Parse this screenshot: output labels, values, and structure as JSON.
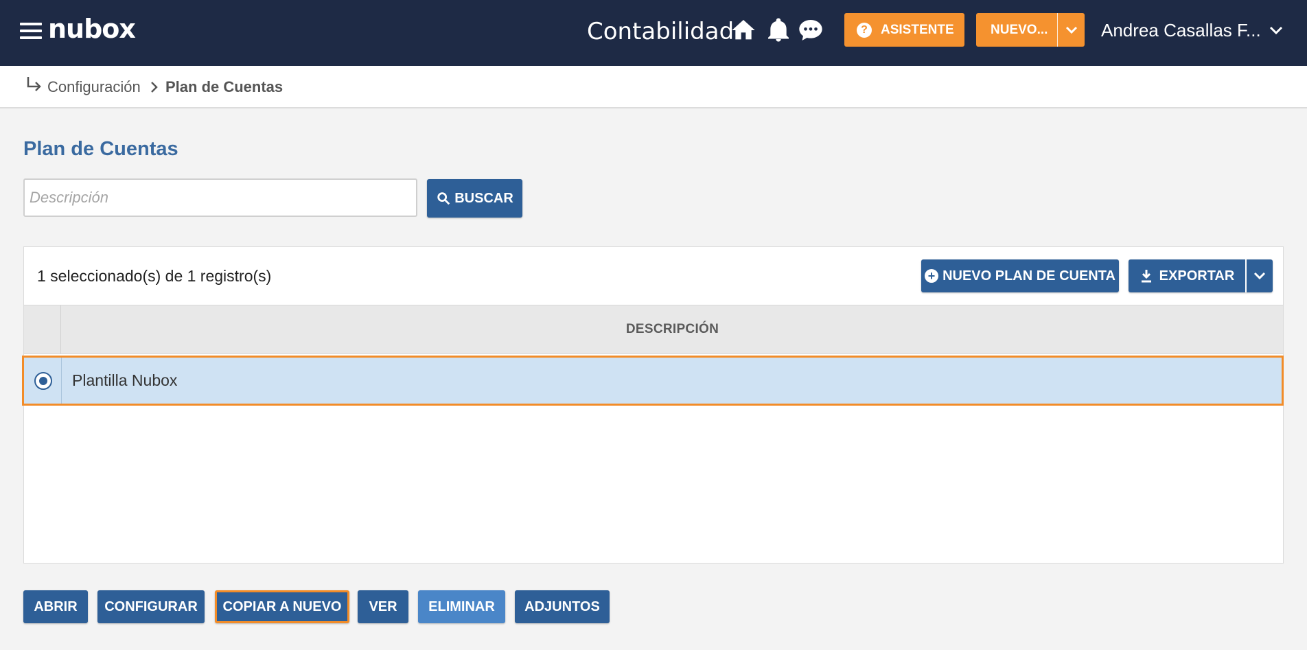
{
  "header": {
    "logo": "nubox",
    "app_title": "Contabilidad",
    "asistente_label": "ASISTENTE",
    "nuevo_label": "NUEVO...",
    "user_name": "Andrea Casallas F...",
    "colors": {
      "bar": "#1e2a45",
      "accent": "#f5922f"
    },
    "icons": [
      "menu-icon",
      "home-icon",
      "bell-icon",
      "chat-icon",
      "help-icon",
      "chevron-down-icon"
    ]
  },
  "breadcrumb": {
    "items": [
      "Configuración",
      "Plan de Cuentas"
    ]
  },
  "page": {
    "title": "Plan de Cuentas",
    "search": {
      "placeholder": "Descripción",
      "value": "",
      "button_label": "BUSCAR"
    }
  },
  "table": {
    "count_text": "1 seleccionado(s) de 1 registro(s)",
    "nuevo_plan_label": "NUEVO PLAN DE CUENTA",
    "exportar_label": "EXPORTAR",
    "columns": [
      "DESCRIPCIÓN"
    ],
    "rows": [
      {
        "descripcion": "Plantilla Nubox",
        "selected": true
      }
    ]
  },
  "actions": {
    "abrir": "ABRIR",
    "configurar": "CONFIGURAR",
    "copiar": "COPIAR A NUEVO",
    "ver": "VER",
    "eliminar": "ELIMINAR",
    "adjuntos": "ADJUNTOS"
  }
}
